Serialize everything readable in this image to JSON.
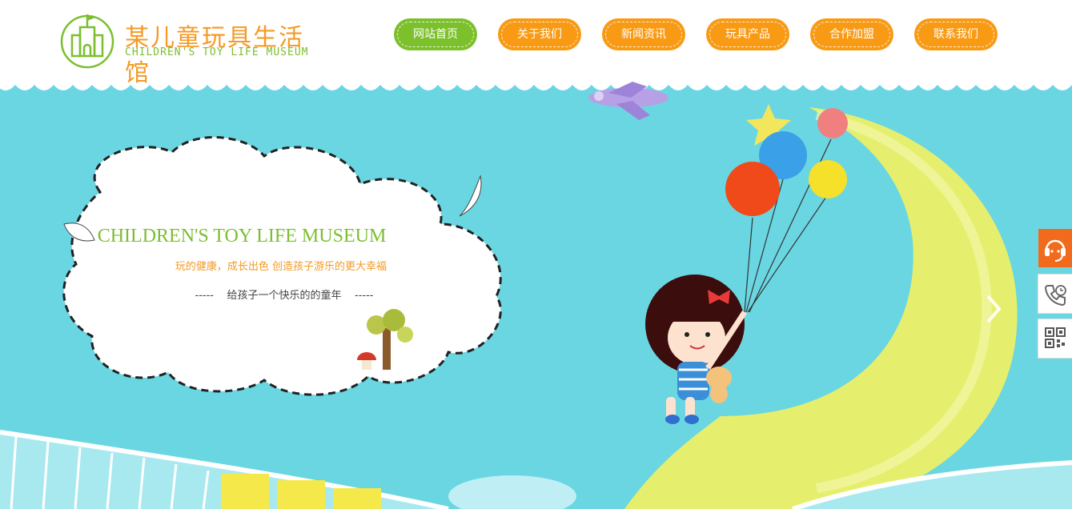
{
  "brand": {
    "name_cn": "某儿童玩具生活馆",
    "name_en": "CHILDREN'S TOY LIFE MUSEUM",
    "logo_icon": "castle-icon",
    "primary_color": "#f99a14",
    "accent_color": "#7cc02c"
  },
  "nav": {
    "items": [
      {
        "label": "网站首页",
        "active": true
      },
      {
        "label": "关于我们",
        "active": false
      },
      {
        "label": "新闻资讯",
        "active": false
      },
      {
        "label": "玩具产品",
        "active": false
      },
      {
        "label": "合作加盟",
        "active": false
      },
      {
        "label": "联系我们",
        "active": false
      }
    ]
  },
  "banner": {
    "title": "CHILDREN'S TOY LIFE MUSEUM",
    "subtitle": "玩的健康，成长出色  创造孩子游乐的更大幸福",
    "tagline": "-----    给孩子一个快乐的的童年    -----",
    "prev_icon": "chevron-left-icon",
    "next_icon": "chevron-right-icon"
  },
  "sidebar": {
    "items": [
      {
        "icon": "customer-service-icon"
      },
      {
        "icon": "phone-icon"
      },
      {
        "icon": "qr-code-icon"
      }
    ]
  }
}
